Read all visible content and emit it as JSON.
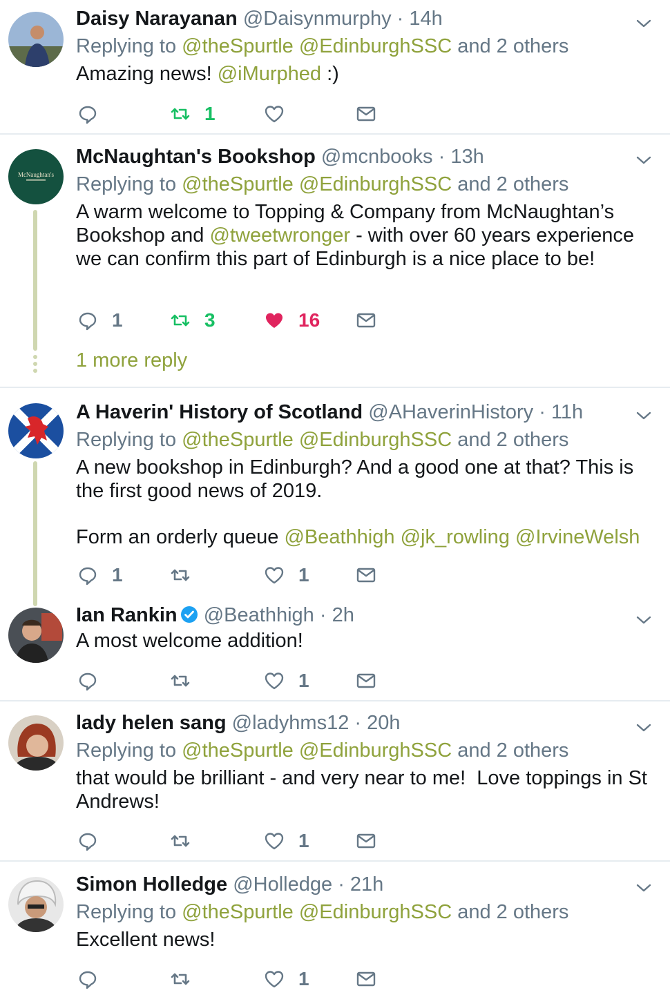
{
  "tweets": [
    {
      "name": "Daisy Narayanan",
      "handle": "@Daisynmurphy",
      "time": "14h",
      "replying_prefix": "Replying to",
      "reply_link1": "@theSpurtle",
      "reply_link2": "@EdinburghSSC",
      "reply_suffix": "and 2 others",
      "text_plain": "Amazing news!",
      "text_link": "@iMurphed",
      "text_after": ":)",
      "reply_count": "",
      "retweet_count": "1",
      "like_count": ""
    },
    {
      "name": "McNaughtan's Bookshop",
      "handle": "@mcnbooks",
      "time": "13h",
      "replying_prefix": "Replying to",
      "reply_link1": "@theSpurtle",
      "reply_link2": "@EdinburghSSC",
      "reply_suffix": "and 2 others",
      "text_a": "A warm welcome to Topping & Company from McNaughtan’s Bookshop and",
      "text_link": "@tweetwronger",
      "text_b": "- with over 60 years experience we can confirm this part of Edinburgh is a nice place to be!",
      "reply_count": "1",
      "retweet_count": "3",
      "like_count": "16",
      "more_reply": "1 more reply",
      "avatar_text": "McNaughtan's"
    },
    {
      "name": "A Haverin' History of Scotland",
      "handle": "@AHaverinHistory",
      "time": "11h",
      "replying_prefix": "Replying to",
      "reply_link1": "@theSpurtle",
      "reply_link2": "@EdinburghSSC",
      "reply_suffix": "and 2 others",
      "text_p1": "A new bookshop in Edinburgh? And a good one at that? This is the first good news of 2019.",
      "text_p2": "Form an orderly queue",
      "text_link1": "@Beathhigh",
      "text_link2": "@jk_rowling",
      "text_link3": "@IrvineWelsh",
      "reply_count": "1",
      "retweet_count": "",
      "like_count": "1"
    },
    {
      "name": "Ian Rankin",
      "handle": "@Beathhigh",
      "time": "2h",
      "text": "A most welcome addition!",
      "reply_count": "",
      "retweet_count": "",
      "like_count": "1"
    },
    {
      "name": "lady helen sang",
      "handle": "@ladyhms12",
      "time": "20h",
      "replying_prefix": "Replying to",
      "reply_link1": "@theSpurtle",
      "reply_link2": "@EdinburghSSC",
      "reply_suffix": "and 2 others",
      "text": "that would be brilliant - and very near to me!  Love toppings in St Andrews!",
      "reply_count": "",
      "retweet_count": "",
      "like_count": "1"
    },
    {
      "name": "Simon Holledge",
      "handle": "@Holledge",
      "time": "21h",
      "replying_prefix": "Replying to",
      "reply_link1": "@theSpurtle",
      "reply_link2": "@EdinburghSSC",
      "reply_suffix": "and 2 others",
      "text": "Excellent news!",
      "reply_count": "",
      "retweet_count": "",
      "like_count": "1"
    }
  ],
  "meta_separator": "·",
  "colors": {
    "link": "#8fa23c",
    "retweet_active": "#17bf63",
    "like_active": "#e0245e",
    "icon_gray": "#657786",
    "thread_line": "#cfd7b0"
  }
}
